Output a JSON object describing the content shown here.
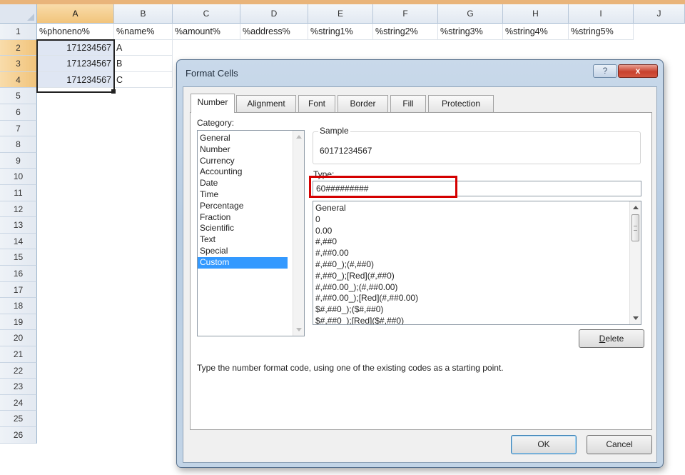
{
  "spreadsheet": {
    "columns": [
      "A",
      "B",
      "C",
      "D",
      "E",
      "F",
      "G",
      "H",
      "I",
      "J"
    ],
    "rows": [
      "1",
      "2",
      "3",
      "4",
      "5",
      "6",
      "7",
      "8",
      "9",
      "10",
      "11",
      "12",
      "13",
      "14",
      "15",
      "16",
      "17",
      "18",
      "19",
      "20",
      "21",
      "22",
      "23",
      "24",
      "25",
      "26"
    ],
    "header_row": [
      "%phoneno%",
      "%name%",
      "%amount%",
      "%address%",
      "%string1%",
      "%string2%",
      "%string3%",
      "%string4%",
      "%string5%"
    ],
    "data_rows": [
      {
        "phone": "171234567",
        "name": "A"
      },
      {
        "phone": "171234567",
        "name": "B"
      },
      {
        "phone": "171234567",
        "name": "C"
      }
    ]
  },
  "dialog": {
    "title": "Format Cells",
    "help_label": "?",
    "close_label": "x",
    "tabs": [
      "Number",
      "Alignment",
      "Font",
      "Border",
      "Fill",
      "Protection"
    ],
    "active_tab": "Number",
    "category_label": "Category:",
    "categories": [
      "General",
      "Number",
      "Currency",
      "Accounting",
      "Date",
      "Time",
      "Percentage",
      "Fraction",
      "Scientific",
      "Text",
      "Special",
      "Custom"
    ],
    "selected_category": "Custom",
    "sample_label": "Sample",
    "sample_value": "60171234567",
    "type_label": "Type:",
    "type_value": "60#########",
    "type_list": [
      "General",
      "0",
      "0.00",
      "#,##0",
      "#,##0.00",
      "#,##0_);(#,##0)",
      "#,##0_);[Red](#,##0)",
      "#,##0.00_);(#,##0.00)",
      "#,##0.00_);[Red](#,##0.00)",
      "$#,##0_);($#,##0)",
      "$#,##0_);[Red]($#,##0)"
    ],
    "delete_label": "Delete",
    "hint_text": "Type the number format code, using one of the existing codes as a starting point.",
    "ok_label": "OK",
    "cancel_label": "Cancel"
  },
  "colors": {
    "selected_category_bg": "#3399ff",
    "highlight_border": "#d40000",
    "close_button": "#c8412e",
    "selected_header": "#f1c47c"
  }
}
